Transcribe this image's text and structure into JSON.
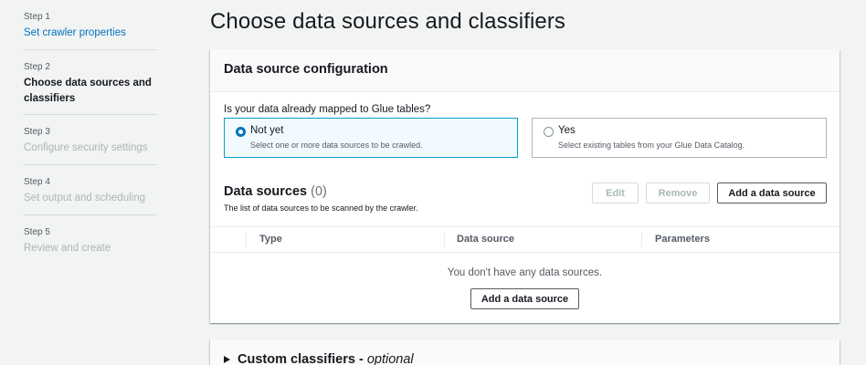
{
  "steps": [
    {
      "num": "Step 1",
      "label": "Set crawler properties",
      "state": "link"
    },
    {
      "num": "Step 2",
      "label": "Choose data sources and classifiers",
      "state": "active"
    },
    {
      "num": "Step 3",
      "label": "Configure security settings",
      "state": "disabled"
    },
    {
      "num": "Step 4",
      "label": "Set output and scheduling",
      "state": "disabled"
    },
    {
      "num": "Step 5",
      "label": "Review and create",
      "state": "disabled"
    }
  ],
  "page": {
    "title": "Choose data sources and classifiers"
  },
  "config": {
    "title": "Data source configuration",
    "question": "Is your data already mapped to Glue tables?",
    "options": [
      {
        "title": "Not yet",
        "desc": "Select one or more data sources to be crawled.",
        "selected": true
      },
      {
        "title": "Yes",
        "desc": "Select existing tables from your Glue Data Catalog.",
        "selected": false
      }
    ]
  },
  "sources": {
    "title": "Data sources",
    "count": "(0)",
    "desc": "The list of data sources to be scanned by the crawler.",
    "edit_label": "Edit",
    "remove_label": "Remove",
    "add_label": "Add a data source",
    "columns": [
      "Type",
      "Data source",
      "Parameters"
    ],
    "empty_text": "You don't have any data sources.",
    "add_bottom_label": "Add a data source"
  },
  "classifiers": {
    "title": "Custom classifiers - ",
    "optional": "optional"
  },
  "colors": {
    "accent": "#0073bb",
    "selected_border": "#00a1c9",
    "selected_bg": "#f1faff"
  }
}
